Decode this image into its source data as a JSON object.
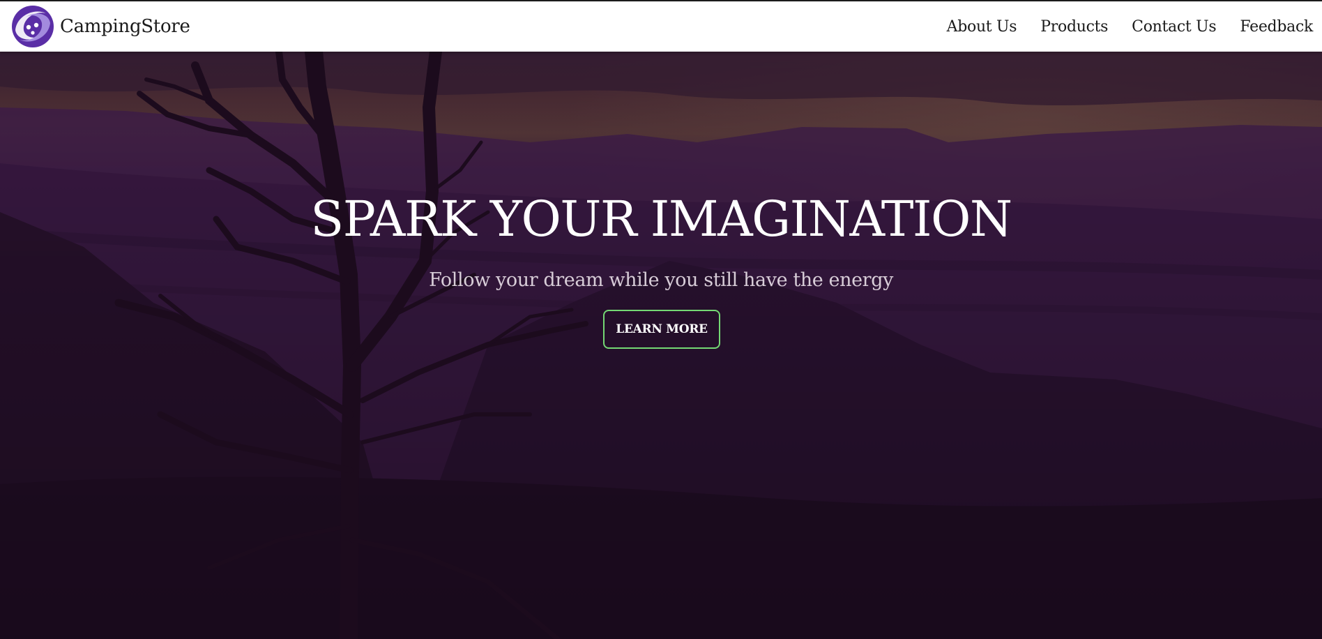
{
  "navbar": {
    "brand_name": "CampingStore",
    "logo_icon": "purple-swirl-logo-icon",
    "links": [
      {
        "label": "About Us"
      },
      {
        "label": "Products"
      },
      {
        "label": "Contact Us"
      },
      {
        "label": "Feedback"
      }
    ]
  },
  "hero": {
    "title": "SPARK YOUR IMAGINATION",
    "subtitle": "Follow your dream while you still have the energy",
    "cta_label": "LEARN MORE",
    "background_image": "dusk canyon landscape with bare tree silhouette, purple overlay"
  },
  "colors": {
    "navbar_bg": "#ffffff",
    "text_dark": "#1a1a1a",
    "hero_overlay": "#2a1033",
    "hero_title": "#ffffff",
    "hero_subtitle": "#d8cdd8",
    "cta_border": "#74d874",
    "logo_purple": "#5a2ea6"
  }
}
